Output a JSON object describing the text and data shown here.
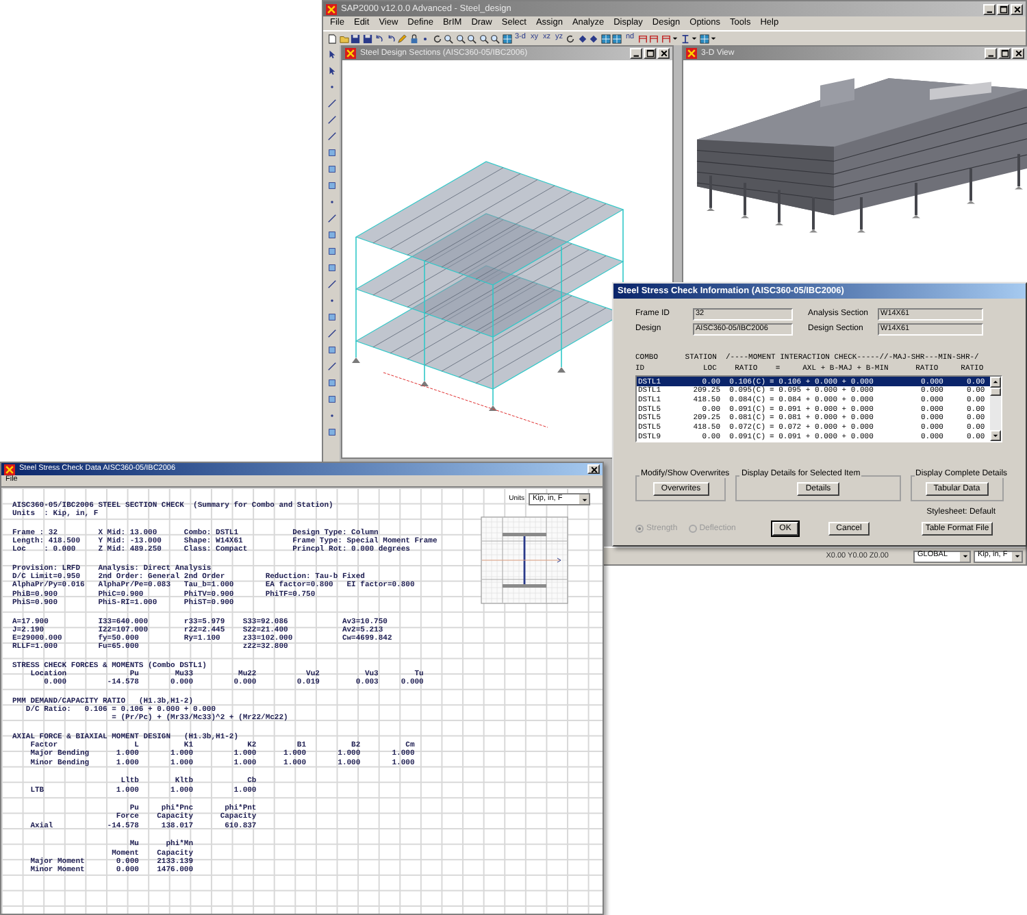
{
  "main_window": {
    "title": "SAP2000 v12.0.0 Advanced  - Steel_design",
    "menu": [
      "File",
      "Edit",
      "View",
      "Define",
      "BrIM",
      "Draw",
      "Select",
      "Assign",
      "Analyze",
      "Display",
      "Design",
      "Options",
      "Tools",
      "Help"
    ],
    "view_buttons": [
      "3-d",
      "xy",
      "xz",
      "yz",
      "nd"
    ],
    "child_windows": [
      {
        "title": "Steel Design Sections  (AISC360-05/IBC2006)",
        "kind": "wireframe"
      },
      {
        "title": "3-D View",
        "kind": "rendered"
      }
    ],
    "status_bar": {
      "coordinates": "X0.00  Y0.00  Z0.00",
      "coordinate_system": "GLOBAL",
      "units": "Kip, in, F"
    }
  },
  "check_dialog": {
    "title": "Steel Stress Check Information  (AISC360-05/IBC2006)",
    "fields": [
      {
        "label": "Frame ID",
        "value": "32"
      },
      {
        "label": "Analysis Section",
        "value": "W14X61"
      },
      {
        "label": "Design",
        "value": "AISC360-05/IBC2006"
      },
      {
        "label": "Design Section",
        "value": "W14X61"
      }
    ],
    "table": {
      "header_lines": [
        "COMBO      STATION  /----MOMENT INTERACTION CHECK-----//-MAJ-SHR---MIN-SHR-/",
        "ID             LOC    RATIO    =     AXL + B-MAJ + B-MIN      RATIO     RATIO"
      ],
      "rows": [
        {
          "combo": "DSTL1",
          "loc": "0.00",
          "ratio": "0.106(C)",
          "equation": "= 0.106 + 0.000 + 0.000",
          "maj_shr": "0.000",
          "min_shr": "0.00",
          "selected": true
        },
        {
          "combo": "DSTL1",
          "loc": "209.25",
          "ratio": "0.095(C)",
          "equation": "= 0.095 + 0.000 + 0.000",
          "maj_shr": "0.000",
          "min_shr": "0.00",
          "selected": false
        },
        {
          "combo": "DSTL1",
          "loc": "418.50",
          "ratio": "0.084(C)",
          "equation": "= 0.084 + 0.000 + 0.000",
          "maj_shr": "0.000",
          "min_shr": "0.00",
          "selected": false
        },
        {
          "combo": "DSTL5",
          "loc": "0.00",
          "ratio": "0.091(C)",
          "equation": "= 0.091 + 0.000 + 0.000",
          "maj_shr": "0.000",
          "min_shr": "0.00",
          "selected": false
        },
        {
          "combo": "DSTL5",
          "loc": "209.25",
          "ratio": "0.081(C)",
          "equation": "= 0.081 + 0.000 + 0.000",
          "maj_shr": "0.000",
          "min_shr": "0.00",
          "selected": false
        },
        {
          "combo": "DSTL5",
          "loc": "418.50",
          "ratio": "0.072(C)",
          "equation": "= 0.072 + 0.000 + 0.000",
          "maj_shr": "0.000",
          "min_shr": "0.00",
          "selected": false
        },
        {
          "combo": "DSTL9",
          "loc": "0.00",
          "ratio": "0.091(C)",
          "equation": "= 0.091 + 0.000 + 0.000",
          "maj_shr": "0.000",
          "min_shr": "0.00",
          "selected": false
        }
      ]
    },
    "groups": [
      {
        "caption": "Modify/Show Overwrites",
        "button": "Overwrites"
      },
      {
        "caption": "Display Details for Selected Item",
        "button": "Details"
      },
      {
        "caption": "Display Complete Details",
        "button": "Tabular Data"
      }
    ],
    "stylesheet": "Stylesheet: Default",
    "options": [
      {
        "label": "Strength",
        "selected": true,
        "disabled": true
      },
      {
        "label": "Deflection",
        "selected": false,
        "disabled": true
      }
    ],
    "buttons": [
      "OK",
      "Cancel"
    ],
    "format_button": "Table Format File"
  },
  "report_window": {
    "title": "Steel Stress Check Data  AISC360-05/IBC2006",
    "menu": [
      "File"
    ],
    "units_label": "Units",
    "units": "Kip, in, F",
    "blocks": [
      [
        "AISC360-05/IBC2006 STEEL SECTION CHECK  (Summary for Combo and Station)",
        "Units  : Kip, in, F"
      ],
      [
        "Frame : 32         X Mid: 13.000      Combo: DSTL1            Design Type: Column",
        "Length: 418.500    Y Mid: -13.000     Shape: W14X61           Frame Type: Special Moment Frame",
        "Loc    : 0.000     Z Mid: 489.250     Class: Compact          Princpl Rot: 0.000 degrees"
      ],
      [
        "Provision: LRFD    Analysis: Direct Analysis",
        "D/C Limit=0.950    2nd Order: General 2nd Order         Reduction: Tau-b Fixed",
        "AlphaPr/Py=0.016   AlphaPr/Pe=0.083   Tau_b=1.000       EA factor=0.800   EI factor=0.800",
        "PhiB=0.900         PhiC=0.900         PhiTV=0.900       PhiTF=0.750",
        "PhiS=0.900         PhiS-RI=1.000      PhiST=0.900"
      ],
      [
        "A=17.900           I33=640.000        r33=5.979    S33=92.086            Av3=10.750",
        "J=2.190            I22=107.000        r22=2.445    S22=21.400            Av2=5.213",
        "E=29000.000        fy=50.000          Ry=1.100     z33=102.000           Cw=4699.842",
        "RLLF=1.000         Fu=65.000                       z22=32.800"
      ],
      [
        "STRESS CHECK FORCES & MOMENTS (Combo DSTL1)",
        "    Location              Pu        Mu33          Mu22           Vu2          Vu3        Tu",
        "       0.000         -14.578       0.000         0.000         0.019        0.003     0.000"
      ],
      [
        "PMM DEMAND/CAPACITY RATIO   (H1.3b,H1-2)",
        "   D/C Ratio:   0.106 = 0.106 + 0.000 + 0.000",
        "                      = (Pr/Pc) + (Mr33/Mc33)^2 + (Mr22/Mc22)"
      ],
      [
        "AXIAL FORCE & BIAXIAL MOMENT DESIGN   (H1.3b,H1-2)",
        "    Factor                 L          K1            K2         B1          B2          Cm",
        "    Major Bending      1.000       1.000         1.000      1.000       1.000       1.000",
        "    Minor Bending      1.000       1.000         1.000      1.000       1.000       1.000"
      ],
      [
        "                        Lltb        Kltb            Cb",
        "    LTB                1.000       1.000         1.000"
      ],
      [
        "                          Pu     phi*Pnc       phi*Pnt",
        "                       Force    Capacity      Capacity",
        "    Axial            -14.578     138.017       610.837"
      ],
      [
        "                          Mu      phi*Mn",
        "                      Moment    Capacity",
        "    Major Moment       0.000    2133.139",
        "    Minor Moment       0.000    1476.000"
      ]
    ]
  }
}
